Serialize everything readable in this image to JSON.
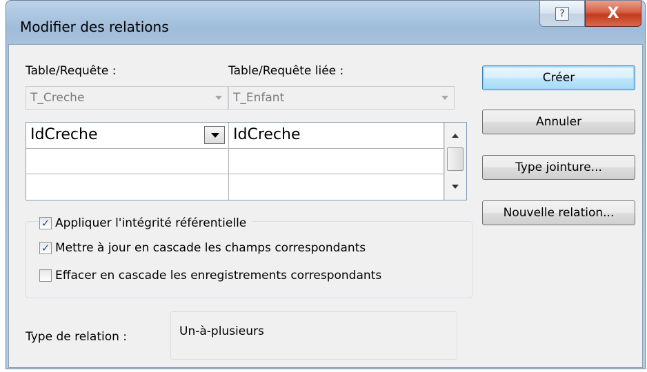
{
  "window": {
    "title": "Modifier des relations",
    "help_glyph": "?",
    "close_glyph": "X"
  },
  "tables": {
    "left_label": "Table/Requête :",
    "right_label": "Table/Requête liée :",
    "left_value": "T_Creche",
    "right_value": "T_Enfant"
  },
  "fields_grid": {
    "rows": [
      {
        "left": "IdCreche",
        "right": "IdCreche"
      },
      {
        "left": "",
        "right": ""
      },
      {
        "left": "",
        "right": ""
      }
    ]
  },
  "options": {
    "enforce_integrity": {
      "label": "Appliquer l'intégrité référentielle",
      "checked": true
    },
    "cascade_update": {
      "label": "Mettre à jour en cascade les champs correspondants",
      "checked": true
    },
    "cascade_delete": {
      "label": "Effacer en cascade les enregistrements correspondants",
      "checked": false
    }
  },
  "relation_type": {
    "label": "Type de relation :",
    "value": "Un-à-plusieurs"
  },
  "buttons": {
    "create": "Créer",
    "cancel": "Annuler",
    "join_type": "Type jointure...",
    "new_relation": "Nouvelle relation..."
  },
  "icons": {
    "check_glyph": "✓"
  }
}
